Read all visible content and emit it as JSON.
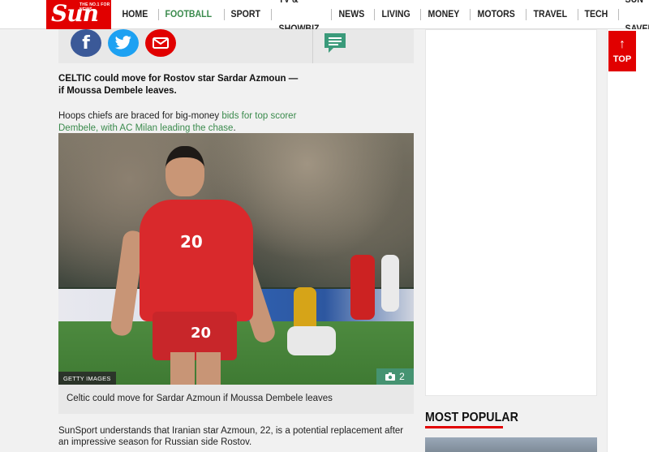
{
  "header": {
    "logo_small": "THE NO.1 FOR NEWS",
    "logo_text": "Sun",
    "nav": [
      {
        "label": "HOME",
        "active": false
      },
      {
        "label": "FOOTBALL",
        "active": true
      },
      {
        "label": "SPORT",
        "active": false
      },
      {
        "label": "TV & SHOWBIZ",
        "active": false
      },
      {
        "label": "NEWS",
        "active": false
      },
      {
        "label": "LIVING",
        "active": false
      },
      {
        "label": "MONEY",
        "active": false
      },
      {
        "label": "MOTORS",
        "active": false
      },
      {
        "label": "TRAVEL",
        "active": false
      },
      {
        "label": "TECH",
        "active": false
      },
      {
        "label": "SUN SAVERS",
        "active": false
      }
    ]
  },
  "share": {
    "facebook_icon": "facebook-icon",
    "twitter_icon": "twitter-icon",
    "email_icon": "email-icon",
    "comments_icon": "comments-icon"
  },
  "article": {
    "lede": "CELTIC could move for Rostov star Sardar Azmoun — if Moussa Dembele leaves.",
    "para1_prefix": "Hoops chiefs are braced for big-money ",
    "para1_link": "bids for top scorer Dembele, with AC Milan leading the chase",
    "para1_suffix": ".",
    "image_credit": "GETTY IMAGES",
    "gallery_count": "2",
    "jersey_number": "20",
    "caption": "Celtic could move for Sardar Azmoun if Moussa Dembele leaves",
    "para2": "SunSport understands that Iranian star Azmoun, 22, is a potential replacement after an impressive season for Russian side Rostov."
  },
  "sidebar": {
    "most_popular_title": "MOST POPULAR"
  },
  "top_button": {
    "arrow": "↑",
    "label": "TOP"
  },
  "colors": {
    "brand_red": "#e10000",
    "accent_green": "#3a8a4c",
    "facebook_blue": "#3b5998",
    "twitter_blue": "#1da1f2"
  }
}
